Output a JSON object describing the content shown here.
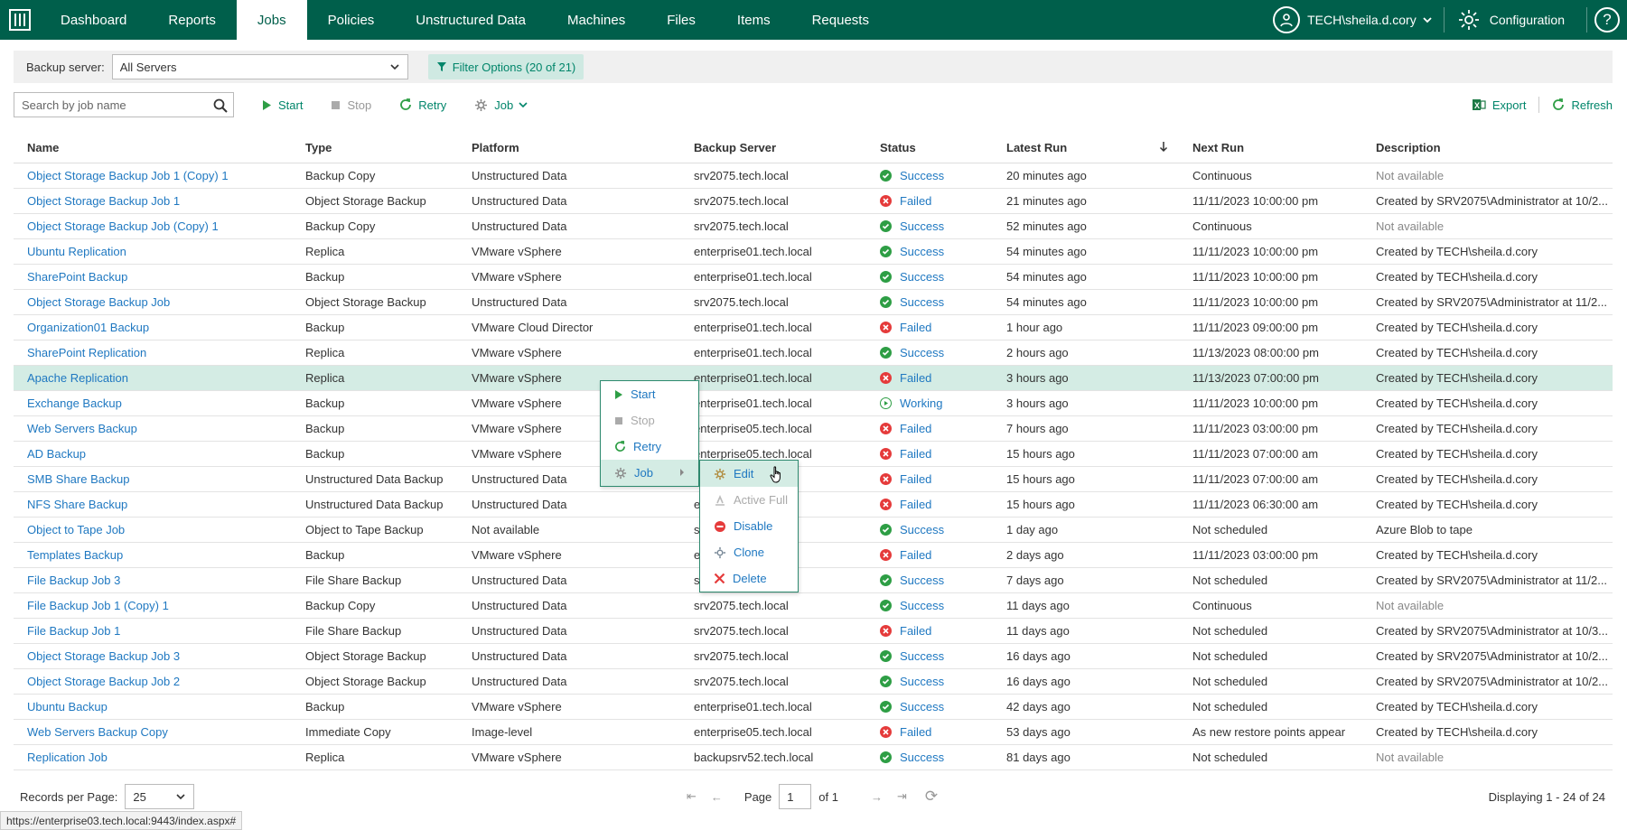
{
  "nav": {
    "items": [
      "Dashboard",
      "Reports",
      "Jobs",
      "Policies",
      "Unstructured Data",
      "Machines",
      "Files",
      "Items",
      "Requests"
    ],
    "active": "Jobs",
    "user": "TECH\\sheila.d.cory",
    "config": "Configuration",
    "help": "?"
  },
  "filter": {
    "backup_server_label": "Backup server:",
    "backup_server_value": "All Servers",
    "filter_options": "Filter Options (20 of 21)"
  },
  "toolbar": {
    "search_placeholder": "Search by job name",
    "start": "Start",
    "stop": "Stop",
    "retry": "Retry",
    "job": "Job",
    "export": "Export",
    "refresh": "Refresh"
  },
  "table": {
    "columns": [
      "Name",
      "Type",
      "Platform",
      "Backup Server",
      "Status",
      "Latest Run",
      "Next Run",
      "Description"
    ],
    "rows": [
      [
        "Object Storage Backup Job 1 (Copy) 1",
        "Backup Copy",
        "Unstructured Data",
        "srv2075.tech.local",
        "Success",
        "20 minutes ago",
        "Continuous",
        "Not available"
      ],
      [
        "Object Storage Backup Job 1",
        "Object Storage Backup",
        "Unstructured Data",
        "srv2075.tech.local",
        "Failed",
        "21 minutes ago",
        "11/11/2023 10:00:00 pm",
        "Created by SRV2075\\Administrator at 10/2..."
      ],
      [
        "Object Storage Backup Job (Copy) 1",
        "Backup Copy",
        "Unstructured Data",
        "srv2075.tech.local",
        "Success",
        "52 minutes ago",
        "Continuous",
        "Not available"
      ],
      [
        "Ubuntu Replication",
        "Replica",
        "VMware vSphere",
        "enterprise01.tech.local",
        "Success",
        "54 minutes ago",
        "11/11/2023 10:00:00 pm",
        "Created by TECH\\sheila.d.cory"
      ],
      [
        "SharePoint Backup",
        "Backup",
        "VMware vSphere",
        "enterprise01.tech.local",
        "Success",
        "54 minutes ago",
        "11/11/2023 10:00:00 pm",
        "Created by TECH\\sheila.d.cory"
      ],
      [
        "Object Storage Backup Job",
        "Object Storage Backup",
        "Unstructured Data",
        "srv2075.tech.local",
        "Success",
        "54 minutes ago",
        "11/11/2023 10:00:00 pm",
        "Created by SRV2075\\Administrator at 11/2..."
      ],
      [
        "Organization01 Backup",
        "Backup",
        "VMware Cloud Director",
        "enterprise01.tech.local",
        "Failed",
        "1 hour ago",
        "11/11/2023 09:00:00 pm",
        "Created by TECH\\sheila.d.cory"
      ],
      [
        "SharePoint Replication",
        "Replica",
        "VMware vSphere",
        "enterprise01.tech.local",
        "Success",
        "2 hours ago",
        "11/13/2023 08:00:00 pm",
        "Created by TECH\\sheila.d.cory"
      ],
      [
        "Apache Replication",
        "Replica",
        "VMware vSphere",
        "enterprise01.tech.local",
        "Failed",
        "3 hours ago",
        "11/13/2023 07:00:00 pm",
        "Created by TECH\\sheila.d.cory"
      ],
      [
        "Exchange Backup",
        "Backup",
        "VMware vSphere",
        "enterprise01.tech.local",
        "Working",
        "3 hours ago",
        "11/11/2023 10:00:00 pm",
        "Created by TECH\\sheila.d.cory"
      ],
      [
        "Web Servers Backup",
        "Backup",
        "VMware vSphere",
        "enterprise05.tech.local",
        "Failed",
        "7 hours ago",
        "11/11/2023 03:00:00 pm",
        "Created by TECH\\sheila.d.cory"
      ],
      [
        "AD Backup",
        "Backup",
        "VMware vSphere",
        "enterprise05.tech.local",
        "Failed",
        "15 hours ago",
        "11/11/2023 07:00:00 am",
        "Created by TECH\\sheila.d.cory"
      ],
      [
        "SMB Share Backup",
        "Unstructured Data Backup",
        "Unstructured Data",
        "",
        "Failed",
        "15 hours ago",
        "11/11/2023 07:00:00 am",
        "Created by TECH\\sheila.d.cory"
      ],
      [
        "NFS Share Backup",
        "Unstructured Data Backup",
        "Unstructured Data",
        "e",
        "Failed",
        "15 hours ago",
        "11/11/2023 06:30:00 am",
        "Created by TECH\\sheila.d.cory"
      ],
      [
        "Object to Tape Job",
        "Object to Tape Backup",
        "Not available",
        "s",
        "Success",
        "1 day ago",
        "Not scheduled",
        "Azure Blob to tape"
      ],
      [
        "Templates Backup",
        "Backup",
        "VMware vSphere",
        "e",
        "Failed",
        "2 days ago",
        "11/11/2023 03:00:00 pm",
        "Created by TECH\\sheila.d.cory"
      ],
      [
        "File Backup Job 3",
        "File Share Backup",
        "Unstructured Data",
        "s",
        "Success",
        "7 days ago",
        "Not scheduled",
        "Created by SRV2075\\Administrator at 11/2..."
      ],
      [
        "File Backup Job 1 (Copy) 1",
        "Backup Copy",
        "Unstructured Data",
        "srv2075.tech.local",
        "Success",
        "11 days ago",
        "Continuous",
        "Not available"
      ],
      [
        "File Backup Job 1",
        "File Share Backup",
        "Unstructured Data",
        "srv2075.tech.local",
        "Failed",
        "11 days ago",
        "Not scheduled",
        "Created by SRV2075\\Administrator at 10/3..."
      ],
      [
        "Object Storage Backup Job 3",
        "Object Storage Backup",
        "Unstructured Data",
        "srv2075.tech.local",
        "Success",
        "16 days ago",
        "Not scheduled",
        "Created by SRV2075\\Administrator at 10/2..."
      ],
      [
        "Object Storage Backup Job 2",
        "Object Storage Backup",
        "Unstructured Data",
        "srv2075.tech.local",
        "Success",
        "16 days ago",
        "Not scheduled",
        "Created by SRV2075\\Administrator at 10/2..."
      ],
      [
        "Ubuntu Backup",
        "Backup",
        "VMware vSphere",
        "enterprise01.tech.local",
        "Success",
        "42 days ago",
        "Not scheduled",
        "Created by TECH\\sheila.d.cory"
      ],
      [
        "Web Servers Backup Copy",
        "Immediate Copy",
        "Image-level",
        "enterprise05.tech.local",
        "Failed",
        "53 days ago",
        "As new restore points appear",
        "Created by TECH\\sheila.d.cory"
      ],
      [
        "Replication Job",
        "Replica",
        "VMware vSphere",
        "backupsrv52.tech.local",
        "Success",
        "81 days ago",
        "Not scheduled",
        "Not available"
      ]
    ],
    "selected_row": 8
  },
  "context_menu": {
    "items": [
      {
        "label": "Start",
        "disabled": false
      },
      {
        "label": "Stop",
        "disabled": true
      },
      {
        "label": "Retry",
        "disabled": false
      },
      {
        "label": "Job",
        "disabled": false
      }
    ],
    "submenu": [
      {
        "label": "Edit",
        "disabled": false
      },
      {
        "label": "Active Full",
        "disabled": true
      },
      {
        "label": "Disable",
        "disabled": false
      },
      {
        "label": "Clone",
        "disabled": false
      },
      {
        "label": "Delete",
        "disabled": false
      }
    ]
  },
  "footer": {
    "records_label": "Records per Page:",
    "records_value": "25",
    "page_label": "Page",
    "page_value": "1",
    "of_label": "of 1",
    "displaying": "Displaying 1 - 24 of 24"
  },
  "statusbar": "https://enterprise03.tech.local:9443/index.aspx#",
  "colors": {
    "brand": "#005f4b",
    "accent": "#00856a",
    "link": "#1f78c1",
    "success": "#2e9e45",
    "failed": "#e53b3b",
    "selected_row": "#d4ece4"
  }
}
